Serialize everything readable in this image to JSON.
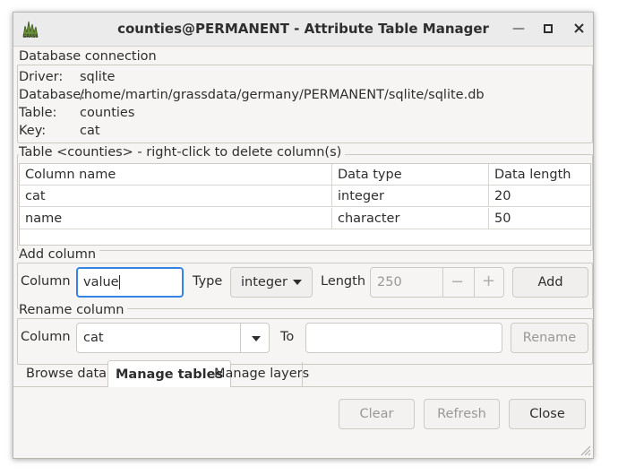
{
  "window": {
    "title": "counties@PERMANENT - Attribute Table Manager",
    "minimize_icon": "minimize-icon",
    "maximize_icon": "maximize-icon",
    "close_icon": "close-icon"
  },
  "db_connection": {
    "group_label": "Database connection",
    "rows": [
      {
        "label": "Driver:",
        "value": "sqlite"
      },
      {
        "label": "Database:",
        "value": "/home/martin/grassdata/germany/PERMANENT/sqlite/sqlite.db"
      },
      {
        "label": "Table:",
        "value": "counties"
      },
      {
        "label": "Key:",
        "value": "cat"
      }
    ]
  },
  "table_section": {
    "group_label": "Table <counties> - right-click to delete column(s)",
    "headers": [
      "Column name",
      "Data type",
      "Data length"
    ],
    "rows": [
      [
        "cat",
        "integer",
        "20"
      ],
      [
        "name",
        "character",
        "50"
      ]
    ]
  },
  "add_column": {
    "group_label": "Add column",
    "column_label": "Column",
    "column_value": "value",
    "type_label": "Type",
    "type_value": "integer",
    "length_label": "Length",
    "length_value": "250",
    "minus": "−",
    "plus": "+",
    "add_button": "Add"
  },
  "rename_column": {
    "group_label": "Rename column",
    "column_label": "Column",
    "column_value": "cat",
    "to_label": "To",
    "to_value": "",
    "rename_button": "Rename"
  },
  "tabs": [
    "Browse data",
    "Manage tables",
    "Manage layers"
  ],
  "active_tab": "Manage tables",
  "footer": {
    "clear_button": "Clear",
    "refresh_button": "Refresh",
    "close_button": "Close"
  },
  "colors": {
    "focus": "#3584e4",
    "window_bg": "#f6f5f4"
  }
}
